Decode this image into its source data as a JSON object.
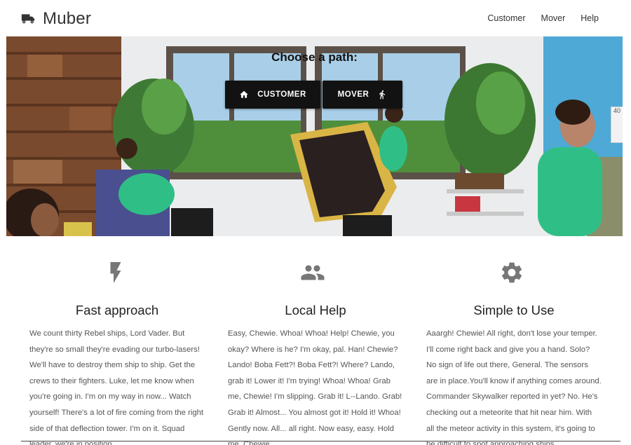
{
  "header": {
    "brand": "Muber",
    "brand_icon": "truck-icon",
    "nav": [
      "Customer",
      "Mover",
      "Help"
    ]
  },
  "hero": {
    "title": "Choose a path:",
    "buttons": {
      "customer": {
        "label": "CUSTOMER",
        "icon": "home-icon"
      },
      "mover": {
        "label": "MOVER",
        "icon": "running-person-icon"
      }
    },
    "side_widget": "40"
  },
  "features": [
    {
      "icon": "flash-icon",
      "title": "Fast approach",
      "text": "We count thirty Rebel ships, Lord Vader. But they're so small they're evading our turbo-lasers! We'll have to destroy them ship to ship. Get the crews to their fighters. Luke, let me know when you're going in. I'm on my way in now... Watch yourself! There's a lot of fire coming from the right side of that deflection tower. I'm on it. Squad leader, we're in position..."
    },
    {
      "icon": "group-icon",
      "title": "Local Help",
      "text": "Easy, Chewie. Whoa! Whoa! Help! Chewie, you okay? Where is he? I'm okay, pal. Han! Chewie? Lando! Boba Fett?! Boba Fett?! Where? Lando, grab it! Lower it! I'm trying! Whoa! Whoa! Grab me, Chewie! I'm slipping. Grab it! L--Lando. Grab! Grab it! Almost... You almost got it! Hold it! Whoa! Gently now. All... all right. Now easy, easy. Hold me, Chewie..."
    },
    {
      "icon": "gear-icon",
      "title": "Simple to Use",
      "text": "Aaargh! Chewie! All right, don't lose your temper. I'll come right back and give you a hand. Solo? No sign of life out there, General. The sensors are in place.You'll know if anything comes around. Commander Skywalker reported in yet? No. He's checking out a meteorite that hit near him. With all the meteor activity in this system, it's going to be difficult to spot approaching ships..."
    }
  ],
  "colors": {
    "button_bg": "#121212",
    "shirt_green": "#2cc68a",
    "icon_grey": "#777777",
    "text_grey": "#555555"
  }
}
